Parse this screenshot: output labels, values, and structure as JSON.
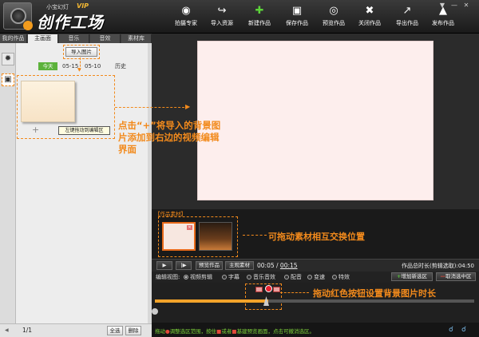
{
  "app": {
    "brand_small": "小宝幻灯",
    "brand_vip": "VIP",
    "brand_main": "创作工场"
  },
  "toolbar": [
    {
      "label": "拍摄专家",
      "icon": "camera-icon"
    },
    {
      "label": "导入资源",
      "icon": "import-icon"
    },
    {
      "label": "新建作品",
      "icon": "new-icon"
    },
    {
      "label": "保存作品",
      "icon": "save-icon"
    },
    {
      "label": "预览作品",
      "icon": "eye-icon"
    },
    {
      "label": "关闭作品",
      "icon": "close-doc-icon"
    },
    {
      "label": "导出作品",
      "icon": "export-icon"
    },
    {
      "label": "发布作品",
      "icon": "publish-icon"
    }
  ],
  "tabs": [
    "我的作品",
    "主画面",
    "音乐",
    "音效",
    "素材库"
  ],
  "left": {
    "import_button": "导入图片",
    "today_badge": "今天",
    "dates": [
      "05-15",
      "05-10",
      "历史"
    ],
    "add_tip": "左键拖动到编辑区",
    "plus": "+",
    "pager": "1/1",
    "select_all": "全选",
    "delete": "删除"
  },
  "materials": {
    "label": "【作品素材】"
  },
  "annotations": {
    "import_hint": "点击“+”将导入的背景图片添加到右边的视频编辑界面",
    "swap_hint": "可拖动素材相互交换位置",
    "duration_hint": "拖动红色按钮设置背景图片时长"
  },
  "timeline": {
    "preview_btn": "预览作品",
    "mode_btn": "主观素材",
    "current_time": "00:05",
    "total_time": "00:15",
    "total_label": "作品总时长(剪辑选取):04:50"
  },
  "edit_row": {
    "label": "编辑视图:",
    "options": [
      "视频剪辑",
      "字幕",
      "音乐音效",
      "配音",
      "变速",
      "特效"
    ],
    "selected": "视频剪辑",
    "add_btn": "增加新选区",
    "cancel_btn": "取消选中区"
  },
  "status": {
    "text_parts": [
      "拖动",
      "调整选区范围，按住",
      "或者",
      "基建预览画面，点击可撤消选区。"
    ]
  },
  "colors": {
    "accent": "#f28a1c",
    "handle_red": "#e8212f",
    "today_green": "#5cb23b",
    "status_green": "#7dd23a"
  }
}
